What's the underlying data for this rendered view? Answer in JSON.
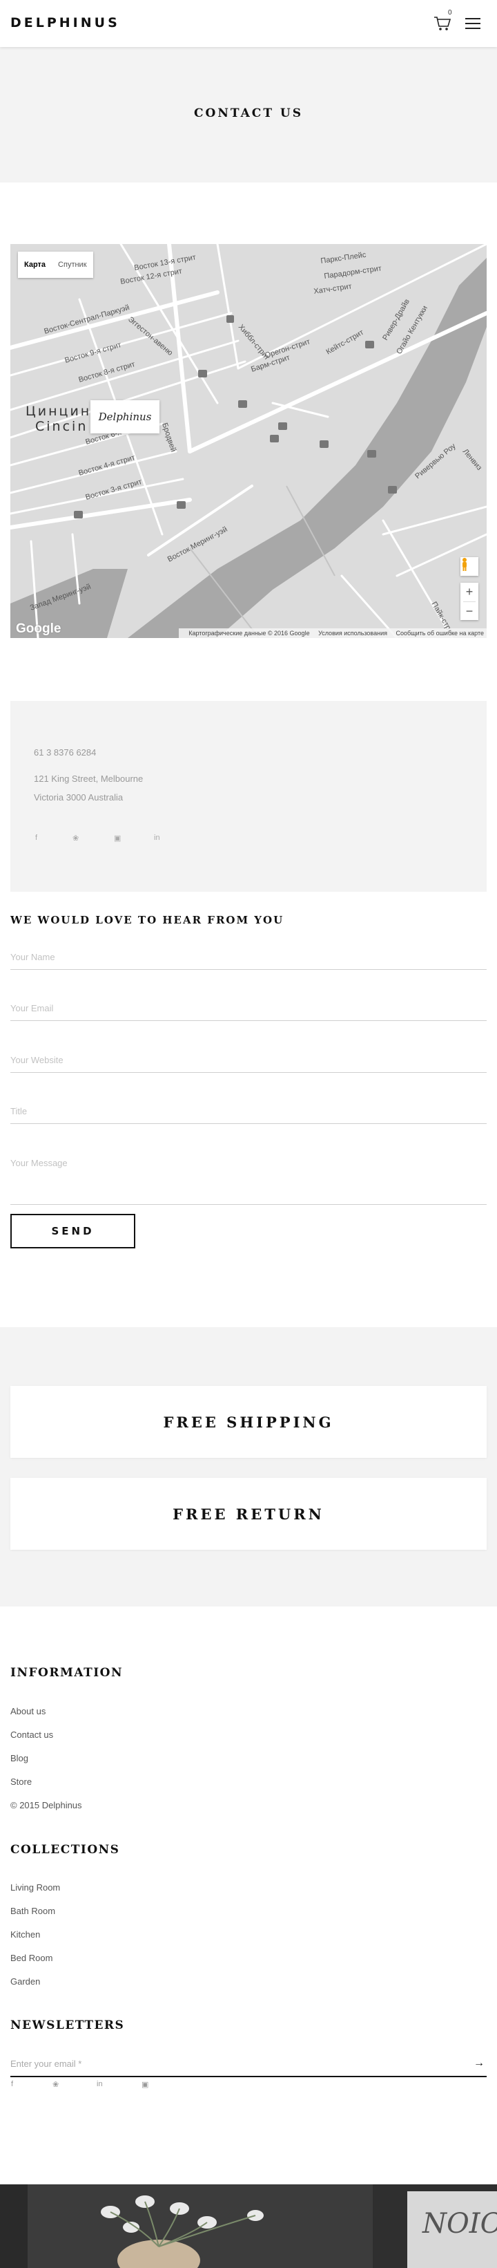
{
  "header": {
    "logo": "DELPHINUS",
    "cart_count": "0"
  },
  "page_title": "CONTACT US",
  "map": {
    "toggle_map": "Карта",
    "toggle_satellite": "Спутник",
    "marker_label": "Delphinus",
    "city_label_1": "Цинцин",
    "city_label_2": "Cincin",
    "streets": [
      "Восток 13-я стрит",
      "Восток 12-я стрит",
      "Восток-Сентрал-Паркуэй",
      "Восток 9-я стрит",
      "Восток 8-я стрит",
      "Восток 6-я стрит",
      "Восток 4-я стрит",
      "Восток 3-я стрит",
      "Паркс-Плейс",
      "Парадорм-стрит",
      "Хатч-стрит",
      "Ривер-Драйв",
      "Орегон-стрит",
      "Барм-стрит",
      "Кейтс-стрит",
      "Ривервью Роу",
      "Огайо Кентукки",
      "Запад Меринг-уэй",
      "Восток Меринг-уэй",
      "Бродвей",
      "Эггестон-авеню",
      "Хиббл-стрит",
      "Ленвиз",
      "Пайк-стрит"
    ],
    "google_logo": "Google",
    "attribution": "Картографические данные © 2016 Google",
    "terms": "Условия использования",
    "report": "Сообщить об ошибке на карте",
    "zoom_in": "+",
    "zoom_out": "−"
  },
  "contact": {
    "phone": "61 3 8376 6284",
    "address_line1": "121 King Street, Melbourne",
    "address_line2": "Victoria 3000 Australia",
    "social": [
      {
        "icon": "facebook-icon",
        "glyph": "f"
      },
      {
        "icon": "twitter-icon",
        "glyph": "❀"
      },
      {
        "icon": "instagram-icon",
        "glyph": "▣"
      },
      {
        "icon": "linkedin-icon",
        "glyph": "in"
      }
    ]
  },
  "form": {
    "title": "WE WOULD LOVE TO HEAR FROM YOU",
    "name_placeholder": "Your Name",
    "email_placeholder": "Your Email",
    "website_placeholder": "Your Website",
    "title_placeholder": "Title",
    "message_placeholder": "Your Message",
    "send_label": "SEND"
  },
  "features": {
    "shipping": "FREE SHIPPING",
    "return": "FREE RETURN"
  },
  "footer": {
    "information_heading": "INFORMATION",
    "information_links": [
      "About us",
      "Contact us",
      "Blog",
      "Store",
      "© 2015 Delphinus"
    ],
    "collections_heading": "COLLECTIONS",
    "collections_links": [
      "Living Room",
      "Bath Room",
      "Kitchen",
      "Bed Room",
      "Garden"
    ],
    "newsletters_heading": "NEWSLETTERS",
    "newsletter_placeholder": "Enter your email *",
    "arrow": "→",
    "social": [
      {
        "icon": "facebook-icon",
        "glyph": "f"
      },
      {
        "icon": "twitter-icon",
        "glyph": "❀"
      },
      {
        "icon": "linkedin-icon",
        "glyph": "in"
      },
      {
        "icon": "instagram-icon",
        "glyph": "▣"
      }
    ],
    "image_text": "NOIO"
  },
  "colors": {
    "band_bg": "#f3f3f3",
    "text_dark": "#111111",
    "muted": "#999999",
    "map_land": "#dcdcdc",
    "map_water": "#a8a8a8"
  }
}
